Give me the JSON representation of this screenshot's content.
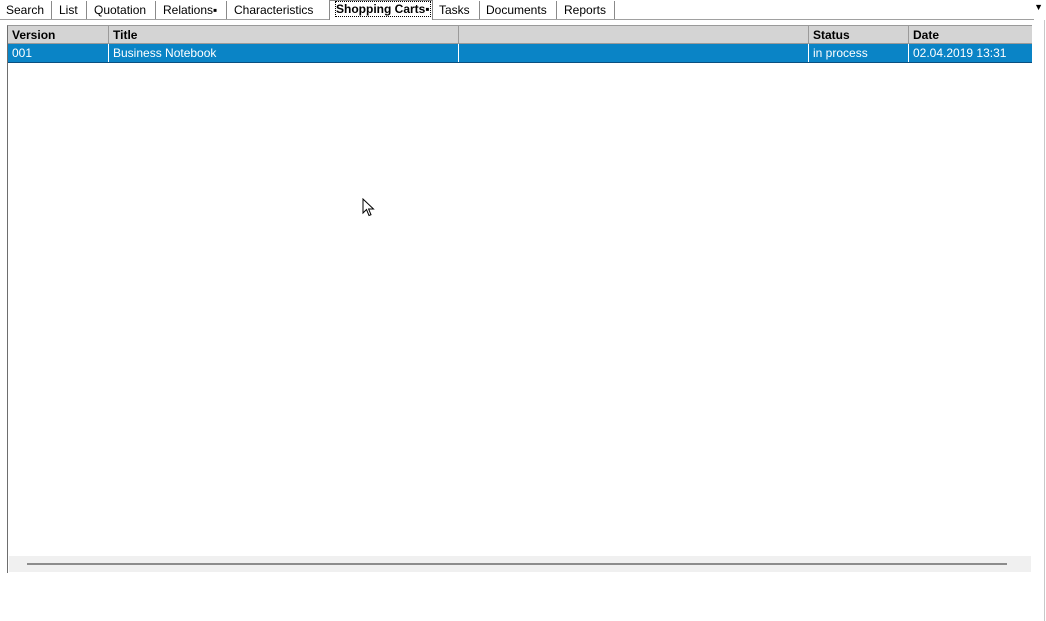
{
  "tabs": [
    {
      "label": "Search"
    },
    {
      "label": "List"
    },
    {
      "label": "Quotation"
    },
    {
      "label": "Relations▪"
    },
    {
      "label": "Characteristics"
    },
    {
      "label": "Shopping Carts▪"
    },
    {
      "label": "Tasks"
    },
    {
      "label": "Documents"
    },
    {
      "label": "Reports"
    }
  ],
  "tab_dropdown": "▼",
  "table": {
    "columns": [
      "Version",
      "Title",
      "",
      "Status",
      "Date"
    ],
    "rows": [
      {
        "version": "001",
        "title": "Business Notebook",
        "extra": "",
        "status": "in process",
        "date": "02.04.2019 13:31"
      }
    ]
  },
  "colors": {
    "selection": "#0a84c6",
    "header_bg": "#d4d4d4"
  }
}
